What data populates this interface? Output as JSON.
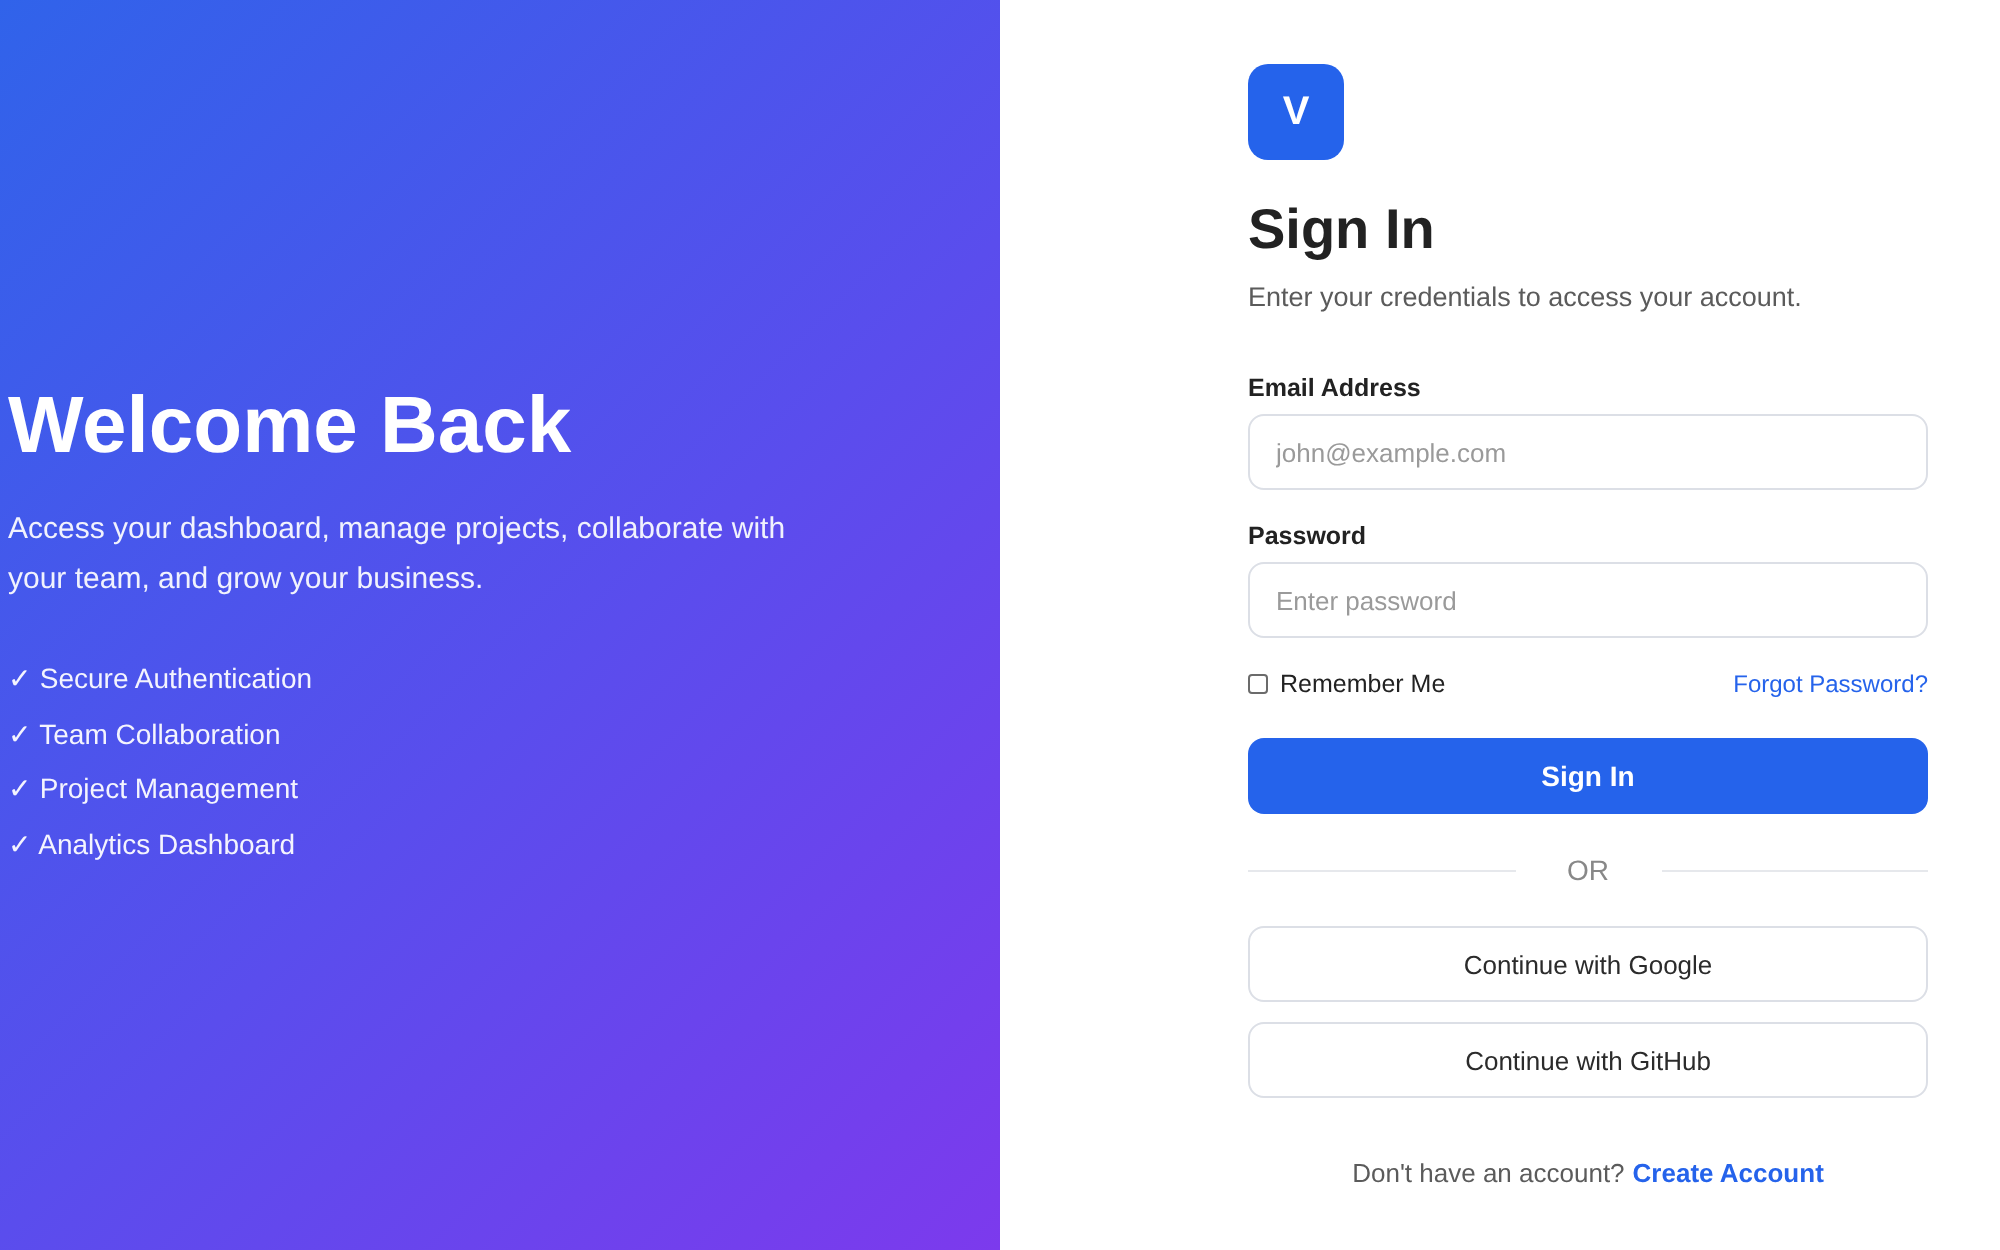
{
  "hero": {
    "title": "Welcome Back",
    "description": "Access your dashboard, manage projects, collaborate with your team, and grow your business.",
    "features": [
      "✓ Secure Authentication",
      "✓ Team Collaboration",
      "✓ Project Management",
      "✓ Analytics Dashboard"
    ]
  },
  "logo": {
    "letter": "V"
  },
  "form": {
    "title": "Sign In",
    "subtitle": "Enter your credentials to access your account.",
    "fields": [
      {
        "label": "Email Address",
        "placeholder": "john@example.com"
      },
      {
        "label": "Password",
        "placeholder": "Enter password"
      }
    ],
    "remember": {
      "label": "Remember Me",
      "checked": false
    },
    "forgot_link": "Forgot Password?",
    "submit": "Sign In",
    "divider": "OR",
    "social_buttons": [
      "Continue with Google",
      "Continue with GitHub"
    ],
    "footer": {
      "text": "Don't have an account?",
      "link": "Create Account"
    }
  }
}
